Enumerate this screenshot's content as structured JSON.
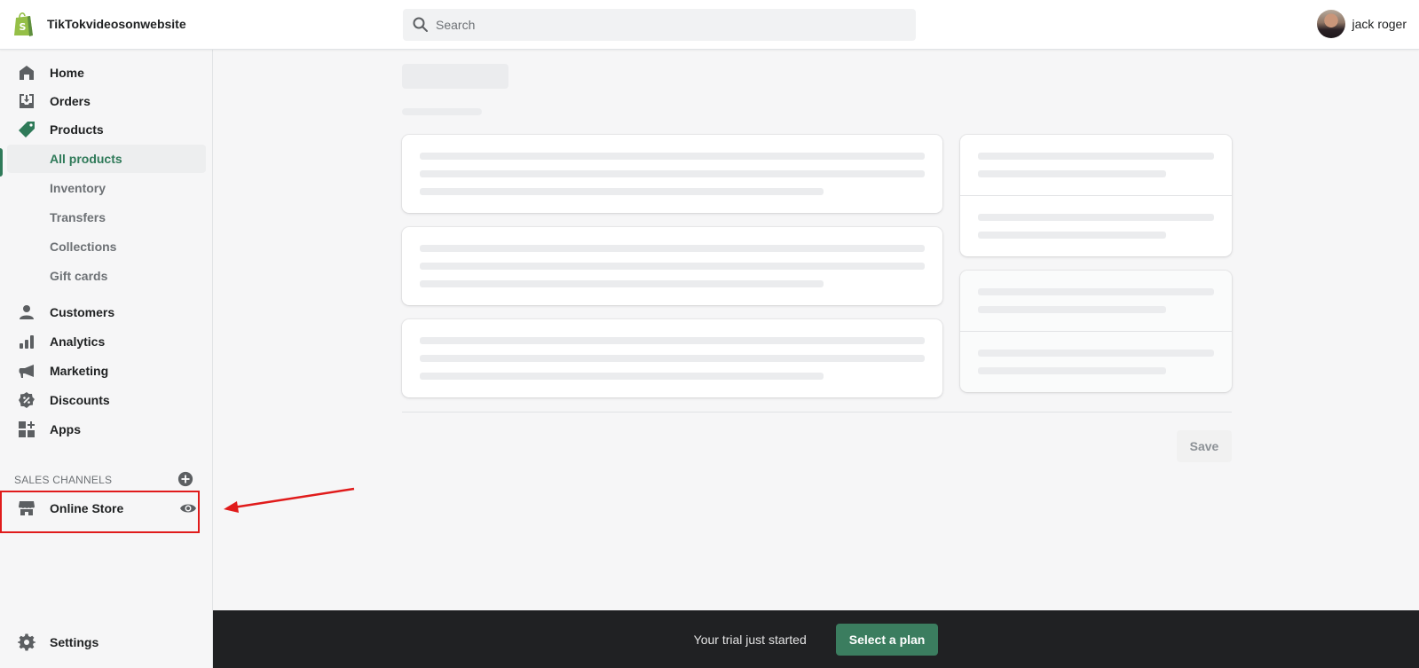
{
  "header": {
    "store_name": "TikTokvideosonwebsite",
    "logo_icon": "shopify-bag-icon",
    "search": {
      "placeholder": "Search",
      "value": ""
    },
    "user": {
      "name": "jack roger",
      "avatar": "user-avatar-photo"
    }
  },
  "sidebar": {
    "items": [
      {
        "label": "Home",
        "icon": "home-icon"
      },
      {
        "label": "Orders",
        "icon": "orders-icon"
      },
      {
        "label": "Products",
        "icon": "tag-icon"
      },
      {
        "label": "All products",
        "active": true
      },
      {
        "label": "Inventory"
      },
      {
        "label": "Transfers"
      },
      {
        "label": "Collections"
      },
      {
        "label": "Gift cards"
      },
      {
        "label": "Customers",
        "icon": "person-icon"
      },
      {
        "label": "Analytics",
        "icon": "bar-chart-icon"
      },
      {
        "label": "Marketing",
        "icon": "megaphone-icon"
      },
      {
        "label": "Discounts",
        "icon": "discount-badge-icon"
      },
      {
        "label": "Apps",
        "icon": "apps-grid-icon"
      }
    ],
    "sales_channels": {
      "title": "SALES CHANNELS",
      "add_icon": "plus-circle-icon",
      "items": [
        {
          "label": "Online Store",
          "icon": "store-icon",
          "action_icon": "eye-icon",
          "highlighted": true
        }
      ]
    },
    "settings": {
      "label": "Settings",
      "icon": "gear-icon"
    }
  },
  "main": {
    "state": "loading-skeleton",
    "save_label": "Save",
    "save_disabled": true
  },
  "trial_bar": {
    "message": "Your trial just started",
    "cta_label": "Select a plan"
  },
  "colors": {
    "accent_green": "#2f7a59",
    "plan_button": "#3b7d5f",
    "trial_bar_bg": "#202123",
    "annotation_red": "#e01b1b",
    "logo_green": "#95bf47"
  }
}
